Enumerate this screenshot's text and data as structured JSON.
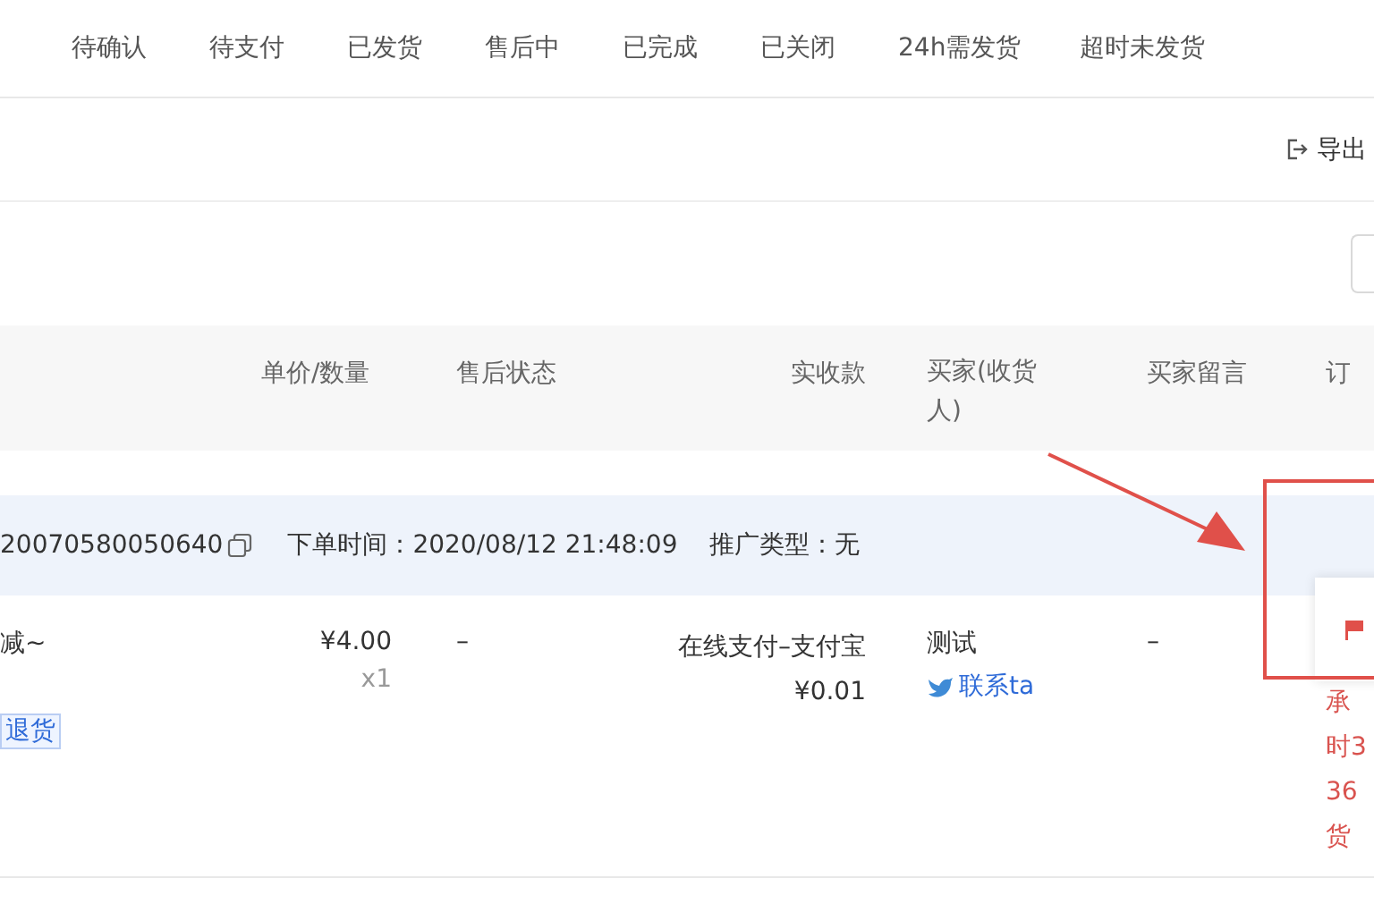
{
  "tabs": [
    {
      "label": "待确认",
      "selected": false
    },
    {
      "label": "待支付",
      "selected": false
    },
    {
      "label": "已发货",
      "selected": false
    },
    {
      "label": "售后中",
      "selected": false
    },
    {
      "label": "已完成",
      "selected": false
    },
    {
      "label": "已关闭",
      "selected": false
    },
    {
      "label": "24h需发货",
      "selected": false
    },
    {
      "label": "超时未发货",
      "selected": false
    }
  ],
  "toolbar": {
    "export_label": "导出"
  },
  "table": {
    "columns": [
      "单价/数量",
      "售后状态",
      "实收款",
      "买家(收货人)",
      "买家留言",
      "订"
    ],
    "order": {
      "order_number": "20070580050640",
      "order_time": "下单时间：2020/08/12 21:48:09",
      "promotion": "推广类型：无"
    },
    "row": {
      "product_text": "减~",
      "tag": "退货",
      "price": "¥4.00",
      "quantity": "x1",
      "after_sale": "–",
      "payment_method": "在线支付–支付宝",
      "received": "¥0.01",
      "buyer": "测试",
      "contact": "联系ta",
      "message": "–",
      "status_lines": [
        "承",
        "时3",
        "36",
        "货"
      ]
    }
  }
}
